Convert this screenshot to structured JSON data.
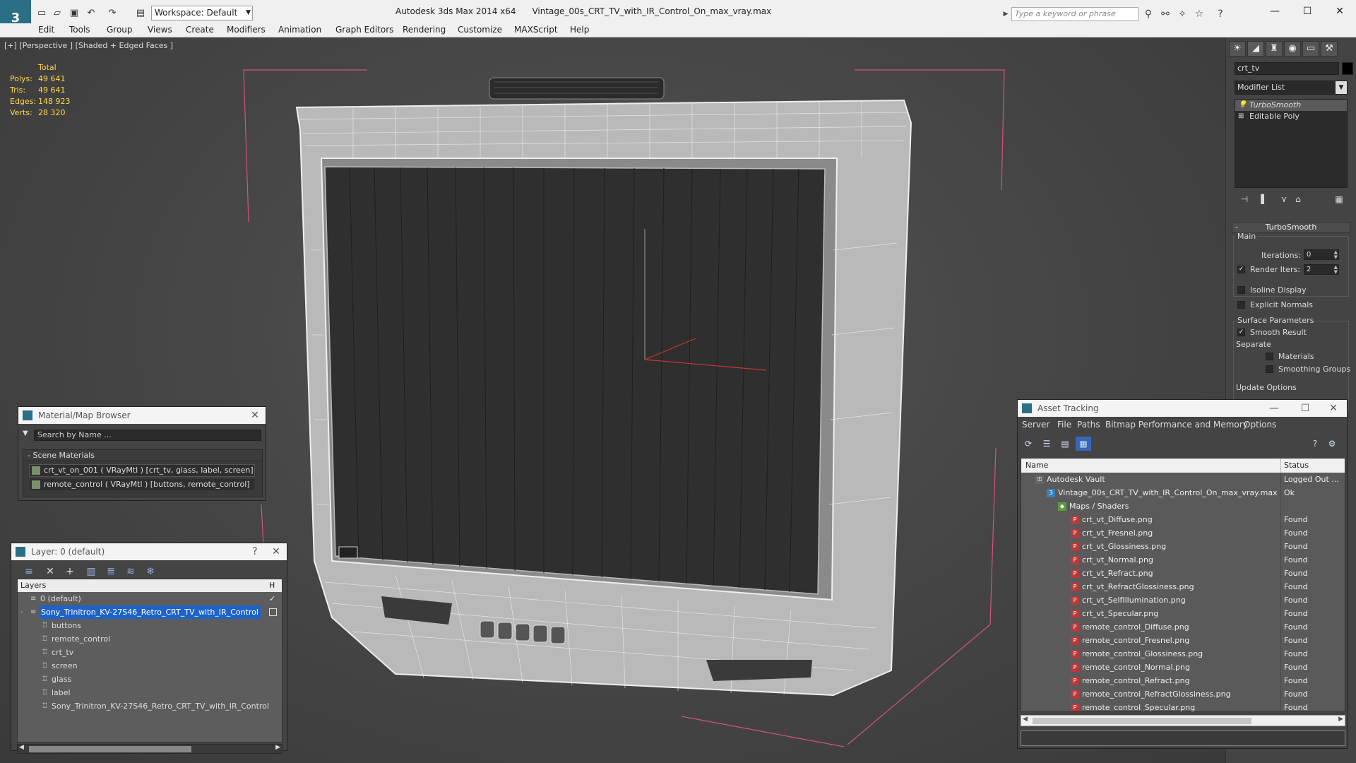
{
  "app": {
    "title": "Autodesk 3ds Max  2014 x64",
    "file_name": "Vintage_00s_CRT_TV_with_IR_Control_On_max_vray.max",
    "workspace": "Workspace: Default",
    "search_placeholder": "Type a keyword or phrase",
    "logo_glyph": "3",
    "accent_color": "#2a6f86"
  },
  "menu": [
    "Edit",
    "Tools",
    "Group",
    "Views",
    "Create",
    "Modifiers",
    "Animation",
    "Graph Editors",
    "Rendering",
    "Customize",
    "MAXScript",
    "Help"
  ],
  "viewport": {
    "label": "[+] [Perspective ] [Shaded + Edged Faces ]",
    "stats": {
      "header": "Total",
      "rows": [
        {
          "k": "Polys:",
          "v": "49 641"
        },
        {
          "k": "Tris:",
          "v": "49 641"
        },
        {
          "k": "Edges:",
          "v": "148 923"
        },
        {
          "k": "Verts:",
          "v": "28 320"
        }
      ]
    }
  },
  "command_panel": {
    "object_name": "crt_tv",
    "modifier_list": "Modifier List",
    "stack": [
      {
        "label": "TurboSmooth",
        "selected": true
      },
      {
        "label": "Editable Poly",
        "selected": false
      }
    ],
    "turbosmooth": {
      "title": "TurboSmooth",
      "main": "Main",
      "iterations_label": "Iterations:",
      "iterations_value": "0",
      "render_iters_label": "Render Iters:",
      "render_iters_value": "2",
      "isoline": "Isoline Display",
      "explicit_normals": "Explicit Normals",
      "surface_params": "Surface Parameters",
      "smooth_result": "Smooth Result",
      "separate": "Separate",
      "materials": "Materials",
      "smoothing_groups": "Smoothing Groups",
      "update_options": "Update Options"
    }
  },
  "material_browser": {
    "title": "Material/Map Browser",
    "search_placeholder": "Search by Name ...",
    "section": "Scene Materials",
    "items": [
      "crt_vt_on_001  ( VRayMtl ) [crt_tv, glass, label, screen]",
      "remote_control  ( VRayMtl ) [buttons, remote_control]"
    ]
  },
  "layer_window": {
    "title": "Layer: 0 (default)",
    "header": "Layers",
    "rows": [
      {
        "label": "0 (default)",
        "level": 1,
        "selected": false
      },
      {
        "label": "Sony_Trinitron_KV-27S46_Retro_CRT_TV_with_IR_Control",
        "level": 1,
        "selected": true
      },
      {
        "label": "buttons",
        "level": 2,
        "selected": false
      },
      {
        "label": "remote_control",
        "level": 2,
        "selected": false
      },
      {
        "label": "crt_tv",
        "level": 2,
        "selected": false
      },
      {
        "label": "screen",
        "level": 2,
        "selected": false
      },
      {
        "label": "glass",
        "level": 2,
        "selected": false
      },
      {
        "label": "label",
        "level": 2,
        "selected": false
      },
      {
        "label": "Sony_Trinitron_KV-27S46_Retro_CRT_TV_with_IR_Control",
        "level": 2,
        "selected": false
      }
    ]
  },
  "asset_tracking": {
    "title": "Asset Tracking",
    "menu": [
      "Server",
      "File",
      "Paths",
      "Bitmap Performance and Memory",
      "Options"
    ],
    "col_name": "Name",
    "col_status": "Status",
    "rows": [
      {
        "name": "Autodesk Vault",
        "status": "Logged Out ...",
        "level": 0,
        "icon": "vault"
      },
      {
        "name": "Vintage_00s_CRT_TV_with_IR_Control_On_max_vray.max",
        "status": "Ok",
        "level": 1,
        "icon": "max"
      },
      {
        "name": "Maps / Shaders",
        "status": "",
        "level": 2,
        "icon": "folder"
      },
      {
        "name": "crt_vt_Diffuse.png",
        "status": "Found",
        "level": 3,
        "icon": "png"
      },
      {
        "name": "crt_vt_Fresnel.png",
        "status": "Found",
        "level": 3,
        "icon": "png"
      },
      {
        "name": "crt_vt_Glossiness.png",
        "status": "Found",
        "level": 3,
        "icon": "png"
      },
      {
        "name": "crt_vt_Normal.png",
        "status": "Found",
        "level": 3,
        "icon": "png"
      },
      {
        "name": "crt_vt_Refract.png",
        "status": "Found",
        "level": 3,
        "icon": "png"
      },
      {
        "name": "crt_vt_RefractGlossiness.png",
        "status": "Found",
        "level": 3,
        "icon": "png"
      },
      {
        "name": "crt_vt_SelfIllumination.png",
        "status": "Found",
        "level": 3,
        "icon": "png"
      },
      {
        "name": "crt_vt_Specular.png",
        "status": "Found",
        "level": 3,
        "icon": "png"
      },
      {
        "name": "remote_control_Diffuse.png",
        "status": "Found",
        "level": 3,
        "icon": "png"
      },
      {
        "name": "remote_control_Fresnel.png",
        "status": "Found",
        "level": 3,
        "icon": "png"
      },
      {
        "name": "remote_control_Glossiness.png",
        "status": "Found",
        "level": 3,
        "icon": "png"
      },
      {
        "name": "remote_control_Normal.png",
        "status": "Found",
        "level": 3,
        "icon": "png"
      },
      {
        "name": "remote_control_Refract.png",
        "status": "Found",
        "level": 3,
        "icon": "png"
      },
      {
        "name": "remote_control_RefractGlossiness.png",
        "status": "Found",
        "level": 3,
        "icon": "png"
      },
      {
        "name": "remote_control_Specular.png",
        "status": "Found",
        "level": 3,
        "icon": "png"
      }
    ]
  }
}
